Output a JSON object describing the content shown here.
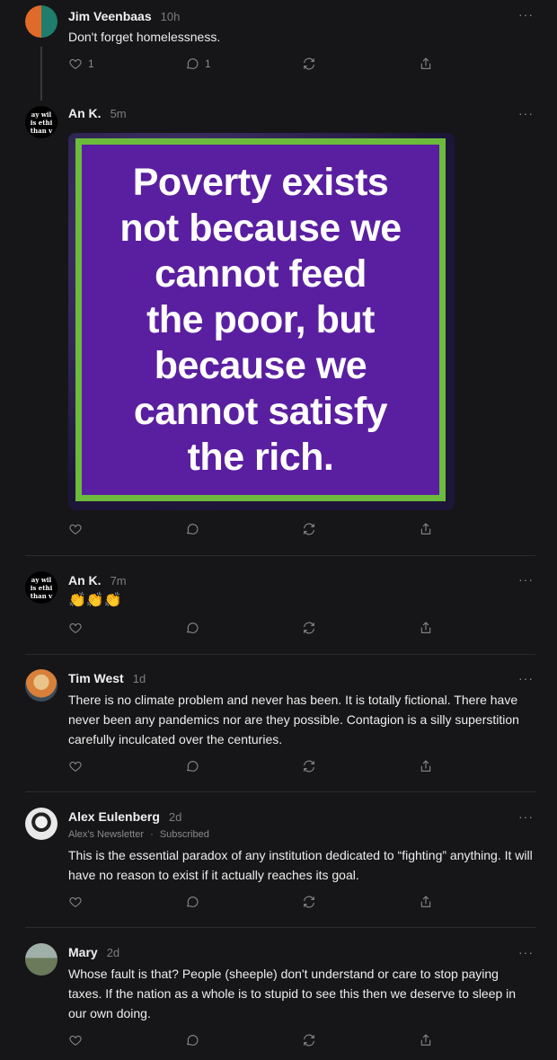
{
  "posts": [
    {
      "author": "Jim Veenbaas",
      "time": "10h",
      "text": "Don't forget homelessness.",
      "likes": "1",
      "replies": "1"
    },
    {
      "author": "An K.",
      "time": "5m",
      "avatar_text": [
        "ay wil",
        "is ethi",
        "than v"
      ],
      "image_text": "Poverty exists\nnot because we\ncannot feed\nthe poor, but\nbecause we\ncannot satisfy\nthe rich."
    },
    {
      "author": "An K.",
      "time": "7m",
      "avatar_text": [
        "ay wil",
        "is ethi",
        "than v"
      ],
      "text": "👏👏👏"
    },
    {
      "author": "Tim West",
      "time": "1d",
      "text": "There is no climate problem and never has been. It is totally fictional. There have never been any pandemics nor are they possible. Contagion is a silly superstition carefully inculcated over the centuries."
    },
    {
      "author": "Alex Eulenberg",
      "time": "2d",
      "newsletter": "Alex's Newsletter",
      "sub_sep": "·",
      "subscribed": "Subscribed",
      "text": "This is the essential paradox of any institution dedicated to “fighting” anything. It will have no reason to exist if it actually reaches its goal."
    },
    {
      "author": "Mary",
      "time": "2d",
      "text": "Whose fault is that? People (sheeple) don't understand or care to stop paying taxes. If the nation as a whole is to stupid to see this then we deserve to sleep in our own doing."
    }
  ],
  "more_label": "···",
  "icons": [
    "heart-icon",
    "comment-icon",
    "restack-icon",
    "share-icon"
  ],
  "colors": {
    "background": "#161618",
    "frame_green": "#6cbb3c",
    "poster_purple": "#5a1fa0"
  }
}
